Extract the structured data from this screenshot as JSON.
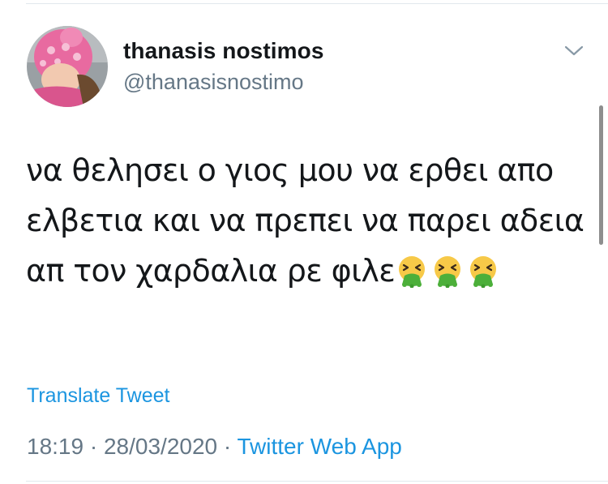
{
  "author": {
    "display_name": "thanasis nostimos",
    "handle": "@thanasisnostimo"
  },
  "tweet": {
    "text": "να θελησει ο γιος μου να ερθει απο ελβετια και να πρεπει να παρει αδεια απ τον χαρδαλια ρε φιλε",
    "emojis": [
      "nauseated-vomiting-face",
      "nauseated-vomiting-face",
      "nauseated-vomiting-face"
    ]
  },
  "actions": {
    "translate_label": "Translate Tweet"
  },
  "meta": {
    "time": "18:19",
    "separator1": " · ",
    "date": "28/03/2020",
    "separator2": " · ",
    "source": "Twitter Web App"
  },
  "colors": {
    "link": "#1b95e0",
    "secondary": "#657786",
    "text": "#14171a"
  }
}
